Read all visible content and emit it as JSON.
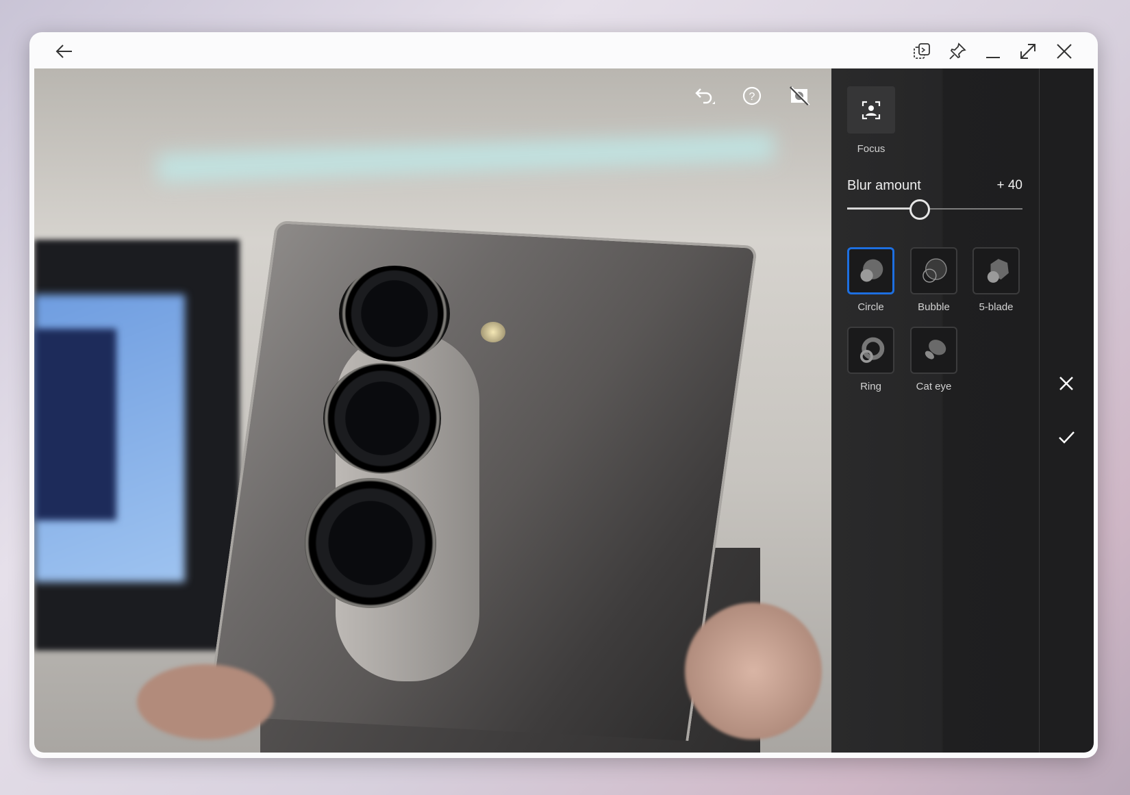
{
  "titlebar": {
    "icons": [
      "back-arrow-icon",
      "snip-window-icon",
      "pin-icon",
      "minimize-icon",
      "maximize-icon",
      "close-icon"
    ]
  },
  "photo_toolbar": {
    "icons": [
      "undo-icon",
      "help-icon",
      "hide-mask-icon"
    ]
  },
  "panel": {
    "focus_label": "Focus",
    "blur_label": "Blur amount",
    "blur_value_text": "+ 40",
    "blur_value": 40,
    "shapes": [
      {
        "label": "Circle",
        "selected": true
      },
      {
        "label": "Bubble",
        "selected": false
      },
      {
        "label": "5-blade",
        "selected": false
      },
      {
        "label": "Ring",
        "selected": false
      },
      {
        "label": "Cat eye",
        "selected": false
      }
    ],
    "accent": "#1d6fe0"
  },
  "actions": {
    "cancel_icon": "close-icon",
    "apply_icon": "checkmark-icon"
  }
}
